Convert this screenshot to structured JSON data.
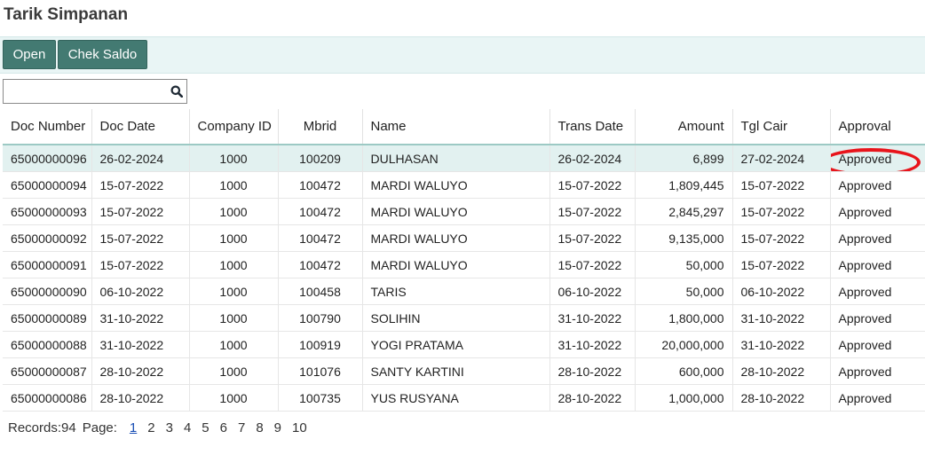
{
  "page": {
    "title": "Tarik Simpanan"
  },
  "toolbar": {
    "open_label": "Open",
    "chek_label": "Chek Saldo"
  },
  "search": {
    "value": "",
    "placeholder": "",
    "icon": "search-icon"
  },
  "table": {
    "headers": [
      "Doc Number",
      "Doc Date",
      "Company ID",
      "Mbrid",
      "Name",
      "Trans Date",
      "Amount",
      "Tgl Cair",
      "Approval"
    ],
    "rows": [
      [
        "65000000096",
        "26-02-2024",
        "1000",
        "100209",
        "DULHASAN",
        "26-02-2024",
        "6,899",
        "27-02-2024",
        "Approved"
      ],
      [
        "65000000094",
        "15-07-2022",
        "1000",
        "100472",
        "MARDI WALUYO",
        "15-07-2022",
        "1,809,445",
        "15-07-2022",
        "Approved"
      ],
      [
        "65000000093",
        "15-07-2022",
        "1000",
        "100472",
        "MARDI WALUYO",
        "15-07-2022",
        "2,845,297",
        "15-07-2022",
        "Approved"
      ],
      [
        "65000000092",
        "15-07-2022",
        "1000",
        "100472",
        "MARDI WALUYO",
        "15-07-2022",
        "9,135,000",
        "15-07-2022",
        "Approved"
      ],
      [
        "65000000091",
        "15-07-2022",
        "1000",
        "100472",
        "MARDI WALUYO",
        "15-07-2022",
        "50,000",
        "15-07-2022",
        "Approved"
      ],
      [
        "65000000090",
        "06-10-2022",
        "1000",
        "100458",
        "TARIS",
        "06-10-2022",
        "50,000",
        "06-10-2022",
        "Approved"
      ],
      [
        "65000000089",
        "31-10-2022",
        "1000",
        "100790",
        "SOLIHIN",
        "31-10-2022",
        "1,800,000",
        "31-10-2022",
        "Approved"
      ],
      [
        "65000000088",
        "31-10-2022",
        "1000",
        "100919",
        "YOGI PRATAMA",
        "31-10-2022",
        "20,000,000",
        "31-10-2022",
        "Approved"
      ],
      [
        "65000000087",
        "28-10-2022",
        "1000",
        "101076",
        "SANTY KARTINI",
        "28-10-2022",
        "600,000",
        "28-10-2022",
        "Approved"
      ],
      [
        "65000000086",
        "28-10-2022",
        "1000",
        "100735",
        "YUS RUSYANA",
        "28-10-2022",
        "1,000,000",
        "28-10-2022",
        "Approved"
      ]
    ]
  },
  "pager": {
    "records_label": "Records:94",
    "page_label": "Page:",
    "pages": [
      "1",
      "2",
      "3",
      "4",
      "5",
      "6",
      "7",
      "8",
      "9",
      "10"
    ],
    "current": "1"
  },
  "colors": {
    "button": "#437a72",
    "toolbar_bg": "#e9f5f5",
    "selected_row": "#e2f1f0",
    "highlight": "#e8141b",
    "current_page": "#1a4fb5"
  }
}
